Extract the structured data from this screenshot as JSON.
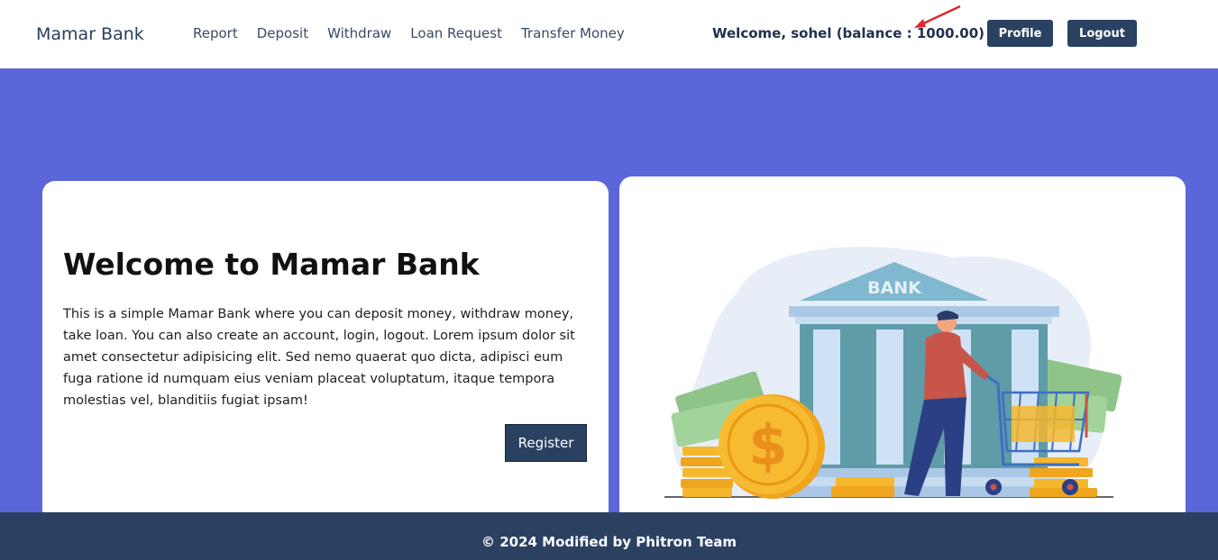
{
  "navbar": {
    "brand": "Mamar Bank",
    "links": [
      {
        "label": "Report"
      },
      {
        "label": "Deposit"
      },
      {
        "label": "Withdraw"
      },
      {
        "label": "Loan Request"
      },
      {
        "label": "Transfer Money"
      }
    ],
    "welcome_text": "Welcome, sohel (balance : 1000.00)",
    "profile_label": "Profile",
    "logout_label": "Logout"
  },
  "hero": {
    "title": "Welcome to Mamar Bank",
    "description": "This is a simple Mamar Bank where you can deposit money, withdraw money, take loan. You can also create an account, login, logout. Lorem ipsum dolor sit amet consectetur adipisicing elit. Sed nemo quaerat quo dicta, adipisci eum fuga ratione id numquam eius veniam placeat voluptatum, itaque tempora molestias vel, blanditiis fugiat ipsam!",
    "register_label": "Register"
  },
  "illustration": {
    "sign_text": "BANK",
    "coin_symbol": "$"
  },
  "footer": {
    "text": "© 2024 Modified by Phitron Team"
  },
  "colors": {
    "page_background": "#5b67d9",
    "primary_dark": "#2b4162",
    "annotation_arrow": "#e0262b"
  }
}
